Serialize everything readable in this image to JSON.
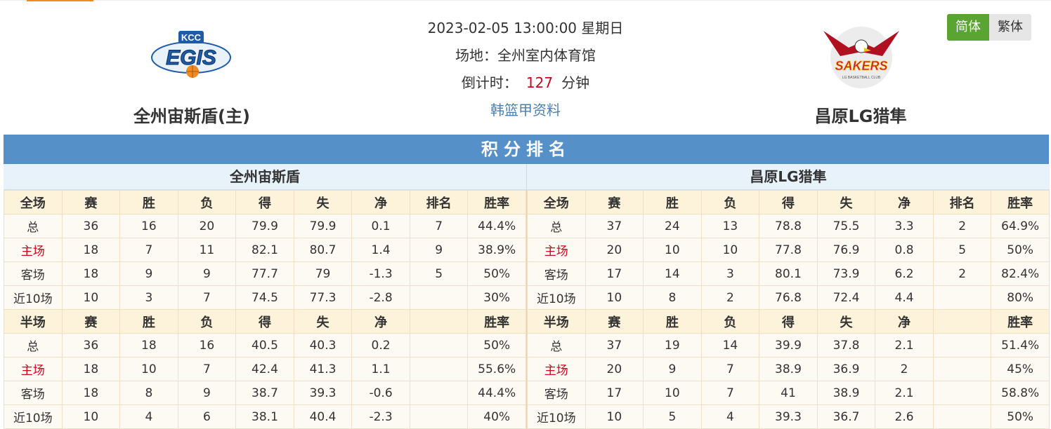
{
  "header": {
    "home_team_name": "全州宙斯盾(主)",
    "away_team_name": "昌原LG猎隼",
    "home_logo": {
      "top_text": "KCC",
      "main_text": "EGIS",
      "colors": {
        "blue": "#1f5ca8",
        "orange": "#f08a24"
      }
    },
    "away_logo": {
      "main_text": "SAKERS",
      "sub_text": "LG BASKETBALL CLUB",
      "colors": {
        "red": "#c8102e",
        "yellow": "#f6c21c"
      }
    },
    "datetime": "2023-02-05 13:00:00 星期日",
    "venue_label": "场地：",
    "venue": "全州室内体育馆",
    "countdown_label": "倒计时：",
    "countdown_value": "127",
    "countdown_unit": "分钟",
    "league_link": "韩篮甲资料"
  },
  "lang": {
    "simplified": "简体",
    "traditional": "繁体",
    "active": "简体",
    "active_color": "#5aa531"
  },
  "standings": {
    "title": "积分排名",
    "title_bg": "#5590c8",
    "home": {
      "name": "全州宙斯盾",
      "full_header": [
        "全场",
        "赛",
        "胜",
        "负",
        "得",
        "失",
        "净",
        "排名",
        "胜率"
      ],
      "full_rows": [
        [
          "总",
          "36",
          "16",
          "20",
          "79.9",
          "79.9",
          "0.1",
          "7",
          "44.4%"
        ],
        [
          "主场",
          "18",
          "7",
          "11",
          "82.1",
          "80.7",
          "1.4",
          "9",
          "38.9%"
        ],
        [
          "客场",
          "18",
          "9",
          "9",
          "77.7",
          "79",
          "-1.3",
          "5",
          "50%"
        ],
        [
          "近10场",
          "10",
          "3",
          "7",
          "74.5",
          "77.3",
          "-2.8",
          "",
          "30%"
        ]
      ],
      "half_header": [
        "半场",
        "赛",
        "胜",
        "负",
        "得",
        "失",
        "净",
        "",
        "胜率"
      ],
      "half_rows": [
        [
          "总",
          "36",
          "18",
          "16",
          "40.5",
          "40.3",
          "0.2",
          "",
          "50%"
        ],
        [
          "主场",
          "18",
          "10",
          "7",
          "42.4",
          "41.3",
          "1.1",
          "",
          "55.6%"
        ],
        [
          "客场",
          "18",
          "8",
          "9",
          "38.7",
          "39.3",
          "-0.6",
          "",
          "44.4%"
        ],
        [
          "近10场",
          "10",
          "4",
          "6",
          "38.1",
          "40.4",
          "-2.3",
          "",
          "40%"
        ]
      ]
    },
    "away": {
      "name": "昌原LG猎隼",
      "full_header": [
        "全场",
        "赛",
        "胜",
        "负",
        "得",
        "失",
        "净",
        "排名",
        "胜率"
      ],
      "full_rows": [
        [
          "总",
          "37",
          "24",
          "13",
          "78.8",
          "75.5",
          "3.3",
          "2",
          "64.9%"
        ],
        [
          "主场",
          "20",
          "10",
          "10",
          "77.8",
          "76.9",
          "0.8",
          "5",
          "50%"
        ],
        [
          "客场",
          "17",
          "14",
          "3",
          "80.1",
          "73.9",
          "6.2",
          "2",
          "82.4%"
        ],
        [
          "近10场",
          "10",
          "8",
          "2",
          "76.8",
          "72.4",
          "4.4",
          "",
          "80%"
        ]
      ],
      "half_header": [
        "半场",
        "赛",
        "胜",
        "负",
        "得",
        "失",
        "净",
        "",
        "胜率"
      ],
      "half_rows": [
        [
          "总",
          "37",
          "19",
          "14",
          "39.9",
          "37.8",
          "2.1",
          "",
          "51.4%"
        ],
        [
          "主场",
          "20",
          "9",
          "7",
          "38.9",
          "36.9",
          "2",
          "",
          "45%"
        ],
        [
          "客场",
          "17",
          "10",
          "7",
          "41",
          "38.9",
          "2.1",
          "",
          "58.8%"
        ],
        [
          "近10场",
          "10",
          "5",
          "4",
          "39.3",
          "36.7",
          "2.6",
          "",
          "50%"
        ]
      ]
    }
  }
}
